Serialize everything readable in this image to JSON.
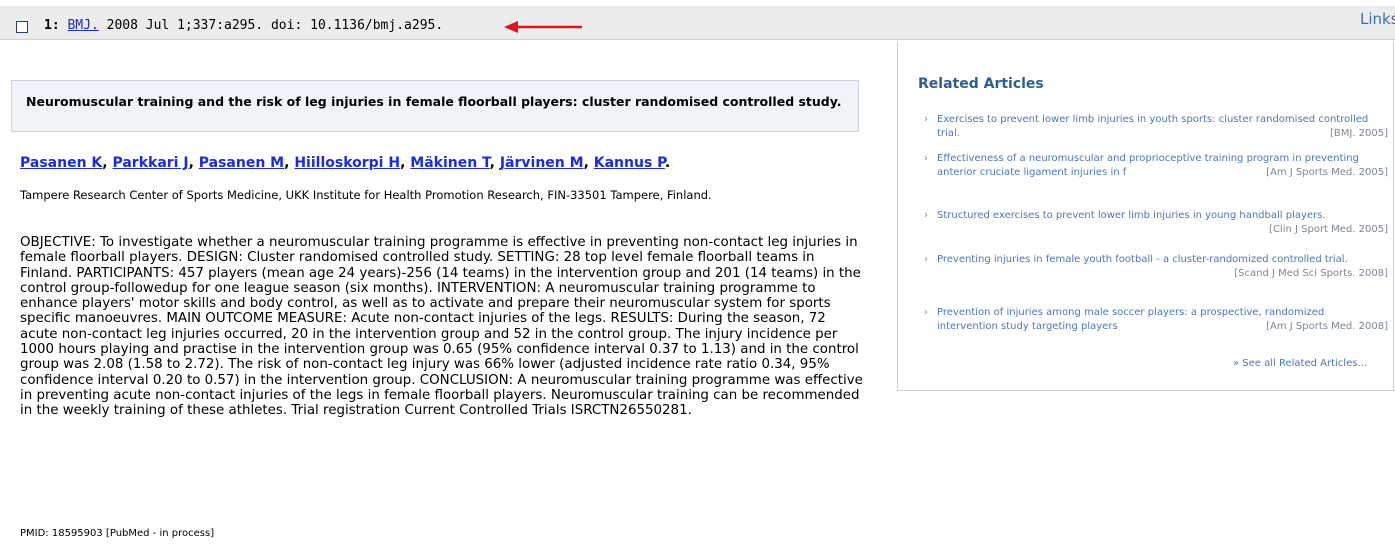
{
  "header": {
    "result_number": "1:",
    "journal_link": "BMJ.",
    "citation_rest": "2008 Jul 1;337:a295. doi: 10.1136/bmj.a295.",
    "links_label": "Links",
    "arrow_color": "#e0141b"
  },
  "article": {
    "title": "Neuromuscular training and the risk of leg injuries in female floorball players: cluster randomised controlled study.",
    "authors": [
      "Pasanen K",
      "Parkkari J",
      "Pasanen M",
      "Hiilloskorpi H",
      "Mäkinen T",
      "Järvinen M",
      "Kannus P"
    ],
    "author_sep": ",",
    "author_end": ".",
    "affiliation": "Tampere Research Center of Sports Medicine, UKK Institute for Health Promotion Research, FIN-33501 Tampere, Finland.",
    "abstract": "OBJECTIVE: To investigate whether a neuromuscular training programme is effective in preventing non-contact leg injuries in female floorball players. DESIGN: Cluster randomised controlled study. SETTING: 28 top level female floorball teams in Finland. PARTICIPANTS: 457 players (mean age 24 years)-256 (14 teams) in the intervention group and 201 (14 teams) in the control group-followedup for one league season (six months). INTERVENTION: A neuromuscular training programme to enhance players' motor skills and body control, as well as to activate and prepare their neuromuscular system for sports specific manoeuvres. MAIN OUTCOME MEASURE: Acute non-contact injuries of the legs. RESULTS: During the season, 72 acute non-contact leg injuries occurred, 20 in the intervention group and 52 in the control group. The injury incidence per 1000 hours playing and practise in the intervention group was 0.65 (95% confidence interval 0.37 to 1.13) and in the control group was 2.08 (1.58 to 2.72). The risk of non-contact leg injury was 66% lower (adjusted incidence rate ratio 0.34, 95% confidence interval 0.20 to 0.57) in the intervention group. CONCLUSION: A neuromuscular training programme was effective in preventing acute non-contact injuries of the legs in female floorball players. Neuromuscular training can be recommended in the weekly training of these athletes. Trial registration Current Controlled Trials ISRCTN26550281.",
    "pmid": "PMID: 18595903 [PubMed - in process]"
  },
  "related": {
    "heading": "Related Articles",
    "bullet": "›",
    "items": [
      {
        "title": "Exercises to prevent lower limb injuries in youth sports: cluster randomised controlled trial.",
        "source": "[BMJ. 2005]"
      },
      {
        "title": "Effectiveness of a neuromuscular and proprioceptive training program in preventing anterior cruciate ligament injuries in f",
        "source": "[Am J Sports Med. 2005]"
      },
      {
        "title": "Structured exercises to prevent lower limb injuries in young handball players.",
        "source": "[Clin J Sport Med. 2005]"
      },
      {
        "title": "Preventing injuries in female youth football - a cluster-randomized controlled trial.",
        "source": "[Scand J Med Sci Sports. 2008]"
      },
      {
        "title": "Prevention of injuries among male soccer players: a prospective, randomized intervention study targeting players",
        "source": "[Am J Sports Med. 2008]"
      }
    ],
    "see_all": "» See all Related Articles..."
  }
}
